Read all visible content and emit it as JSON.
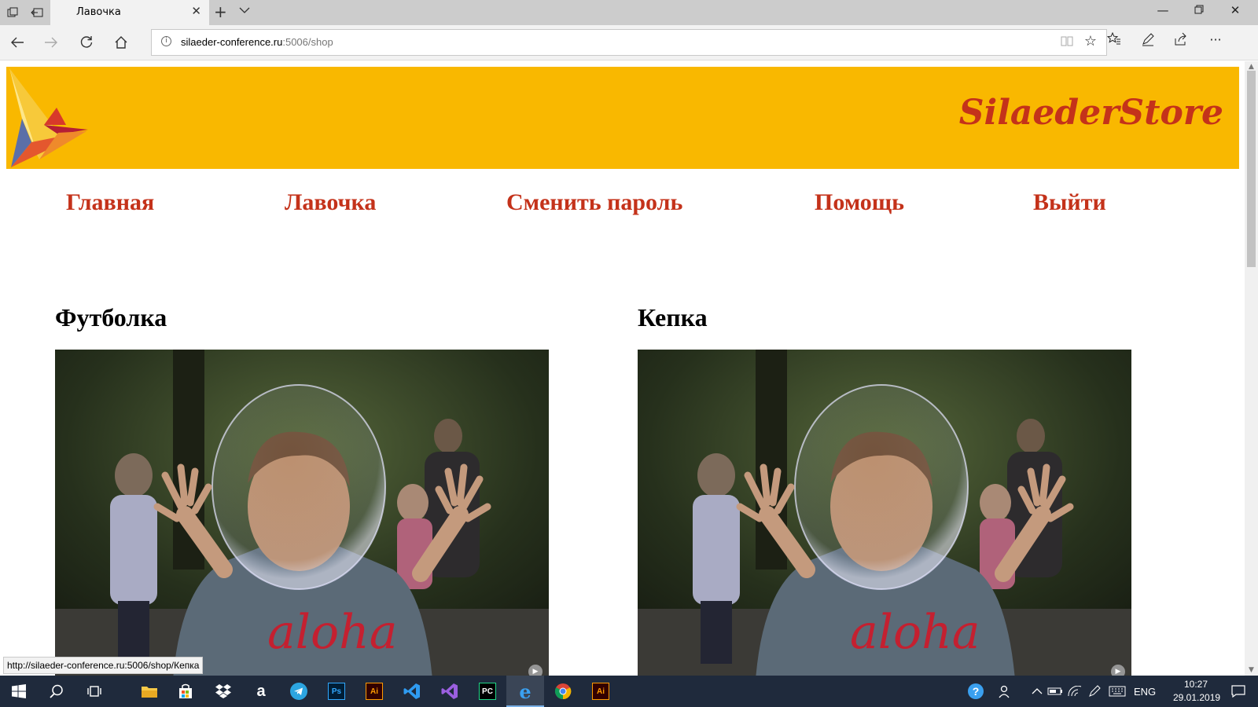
{
  "browser": {
    "tab_title": "Лавочка",
    "url_host": "silaeder-conference.ru",
    "url_path": ":5006/shop",
    "status_url": "http://silaeder-conference.ru:5006/shop/Кепка"
  },
  "site": {
    "brand": "SilaederStore",
    "brand_color": "#c4321a",
    "header_color": "#f9b800",
    "menu": [
      {
        "label": "Главная"
      },
      {
        "label": "Лавочка"
      },
      {
        "label": "Сменить пароль"
      },
      {
        "label": "Помощь"
      },
      {
        "label": "Выйти"
      }
    ]
  },
  "products": [
    {
      "title": "Футболка",
      "image": "boy-soap-bubble-photo"
    },
    {
      "title": "Кепка",
      "image": "boy-soap-bubble-photo"
    }
  ],
  "taskbar": {
    "apps": [
      "start-icon",
      "search-icon",
      "task-view-icon",
      "file-explorer-icon",
      "store-icon",
      "dropbox-icon",
      "amazon-icon",
      "telegram-icon",
      "photoshop-icon",
      "illustrator-icon",
      "vscode-icon",
      "visual-studio-icon",
      "pycharm-icon",
      "edge-icon",
      "chrome-icon",
      "illustrator-icon"
    ],
    "ps_label": "Ps",
    "ai_label": "Ai",
    "pc_label": "PC",
    "lang": "ENG",
    "time": "10:27",
    "date": "29.01.2019"
  }
}
